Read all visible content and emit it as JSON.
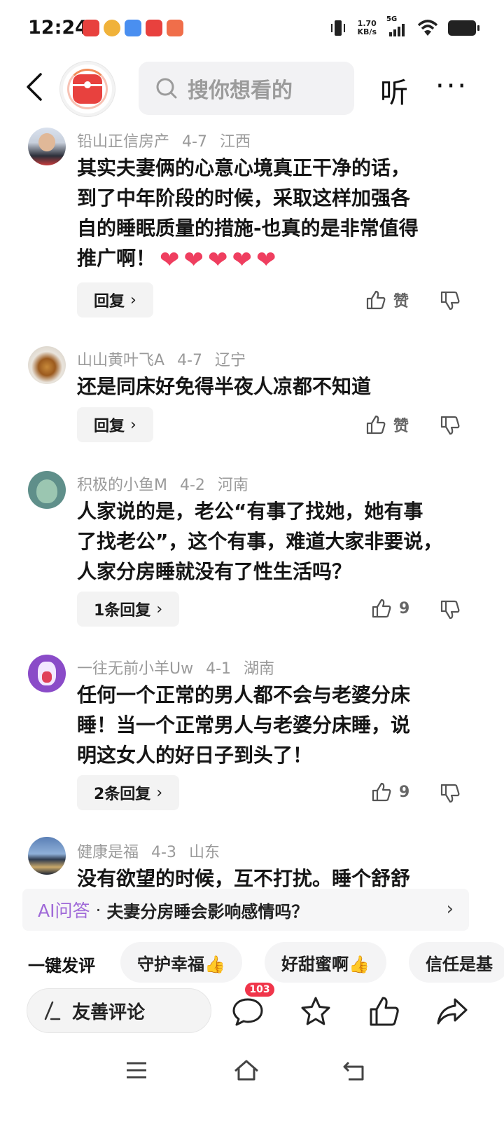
{
  "status_bar": {
    "time": "12:24",
    "net_speed_value": "1.70",
    "net_speed_unit": "KB/s",
    "network": "5G"
  },
  "header": {
    "search_placeholder": "搜你想看的",
    "listen_label": "听",
    "more_label": "···"
  },
  "comments": [
    {
      "user": "铅山正信房产",
      "date": "4-7",
      "location": "江西",
      "lines": [
        "其实夫妻俩的心意心境真正干净的话，",
        "到了中年阶段的时候，采取这样加强各",
        "自的睡眠质量的措施-也真的是非常值得",
        "推广啊！"
      ],
      "hearts": 5,
      "reply_label": "回复",
      "like_label": "赞"
    },
    {
      "user": "山山黄叶飞A",
      "date": "4-7",
      "location": "辽宁",
      "lines": [
        "还是同床好免得半夜人凉都不知道"
      ],
      "reply_label": "回复",
      "like_label": "赞"
    },
    {
      "user": "积极的小鱼M",
      "date": "4-2",
      "location": "河南",
      "lines": [
        "人家说的是，老公“有事了找她，她有事",
        "了找老公”，这个有事，难道大家非要说，",
        "人家分房睡就没有了性生活吗？"
      ],
      "reply_label": "1条回复",
      "like_label": "9"
    },
    {
      "user": "一往无前小羊Uw",
      "date": "4-1",
      "location": "湖南",
      "lines": [
        "任何一个正常的男人都不会与老婆分床",
        "睡！当一个正常男人与老婆分床睡，说",
        "明这女人的好日子到头了！"
      ],
      "reply_label": "2条回复",
      "like_label": "9"
    },
    {
      "user": "健康是福",
      "date": "4-3",
      "location": "山东",
      "lines": [
        "没有欲望的时候，互不打扰。睡个舒舒"
      ]
    }
  ],
  "ai": {
    "tag": "AI问答",
    "dot": "·",
    "question": "夫妻分房睡会影响感情吗？"
  },
  "quick_reply": {
    "label": "一键发评",
    "chips": [
      "守护幸福👍",
      "好甜蜜啊👍",
      "信任是基"
    ]
  },
  "bottom": {
    "comment_placeholder": "友善评论",
    "comment_count": "103"
  },
  "colors": {
    "accent_red": "#e8413e",
    "heart": "#ef3e5f",
    "ai_purple": "#a06ad8",
    "badge_red": "#f0354a"
  }
}
